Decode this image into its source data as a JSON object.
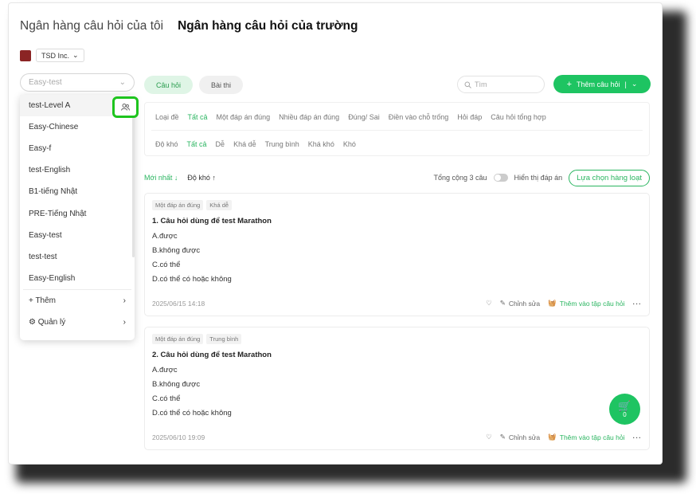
{
  "header": {
    "tab_personal": "Ngân hàng câu hỏi của tôi",
    "tab_school": "Ngân hàng câu hỏi của trường"
  },
  "org": {
    "name": "TSD Inc."
  },
  "bank_select": {
    "value": "Easy-test"
  },
  "dropdown": {
    "items": [
      "test-Level A",
      "Easy-Chinese",
      "Easy-f",
      "test-English",
      "B1-tiếng Nhật",
      "PRE-Tiếng Nhật",
      "Easy-test",
      "test-test",
      "Easy-English"
    ],
    "add_label": "+ Thêm",
    "manage_label": "Quản lý"
  },
  "type_tabs": {
    "questions": "Câu hỏi",
    "exams": "Bài thi"
  },
  "search": {
    "placeholder": "Tìm"
  },
  "add_button": {
    "label": "Thêm câu hỏi"
  },
  "filters": {
    "type_label": "Loại đề",
    "types": [
      "Tất cả",
      "Một đáp án đúng",
      "Nhiều đáp án đúng",
      "Đúng/ Sai",
      "Điền vào chỗ trống",
      "Hỏi đáp",
      "Câu hỏi tổng hợp"
    ],
    "difficulty_label": "Độ khó",
    "difficulties": [
      "Tất cả",
      "Dễ",
      "Khá dễ",
      "Trung bình",
      "Khá khó",
      "Khó"
    ]
  },
  "sort": {
    "newest": "Mới nhất ↓",
    "difficulty": "Độ khó ↑",
    "total": "Tổng cộng 3 câu",
    "show_answer": "Hiển thị đáp án",
    "batch": "Lựa chọn hàng loạt"
  },
  "questions": [
    {
      "tags": [
        "Một đáp án đúng",
        "Khá dễ"
      ],
      "title": "1. Câu hỏi dùng để test Marathon",
      "options": [
        "A.được",
        "B.không được",
        "C.có thể",
        "D.có thể có hoặc không"
      ],
      "date": "2025/06/15 14:18"
    },
    {
      "tags": [
        "Một đáp án đúng",
        "Trung bình"
      ],
      "title": "2. Câu hỏi dùng để test Marathon",
      "options": [
        "A.được",
        "B.không được",
        "C.có thể",
        "D.có thể có hoặc không"
      ],
      "date": "2025/06/10 19:09"
    }
  ],
  "actions": {
    "edit": "Chỉnh sửa",
    "add_to_set": "Thêm vào tập câu hỏi"
  },
  "basket": {
    "count": "0"
  },
  "colors": {
    "accent": "#1ec462",
    "highlight_border": "#1ec41e"
  },
  "icons": [
    "user-group-icon",
    "chevron-down-icon",
    "search-icon",
    "plus-icon",
    "favorite-icon",
    "edit-icon",
    "basket-icon",
    "more-icon",
    "gear-icon",
    "chevron-right-icon"
  ]
}
